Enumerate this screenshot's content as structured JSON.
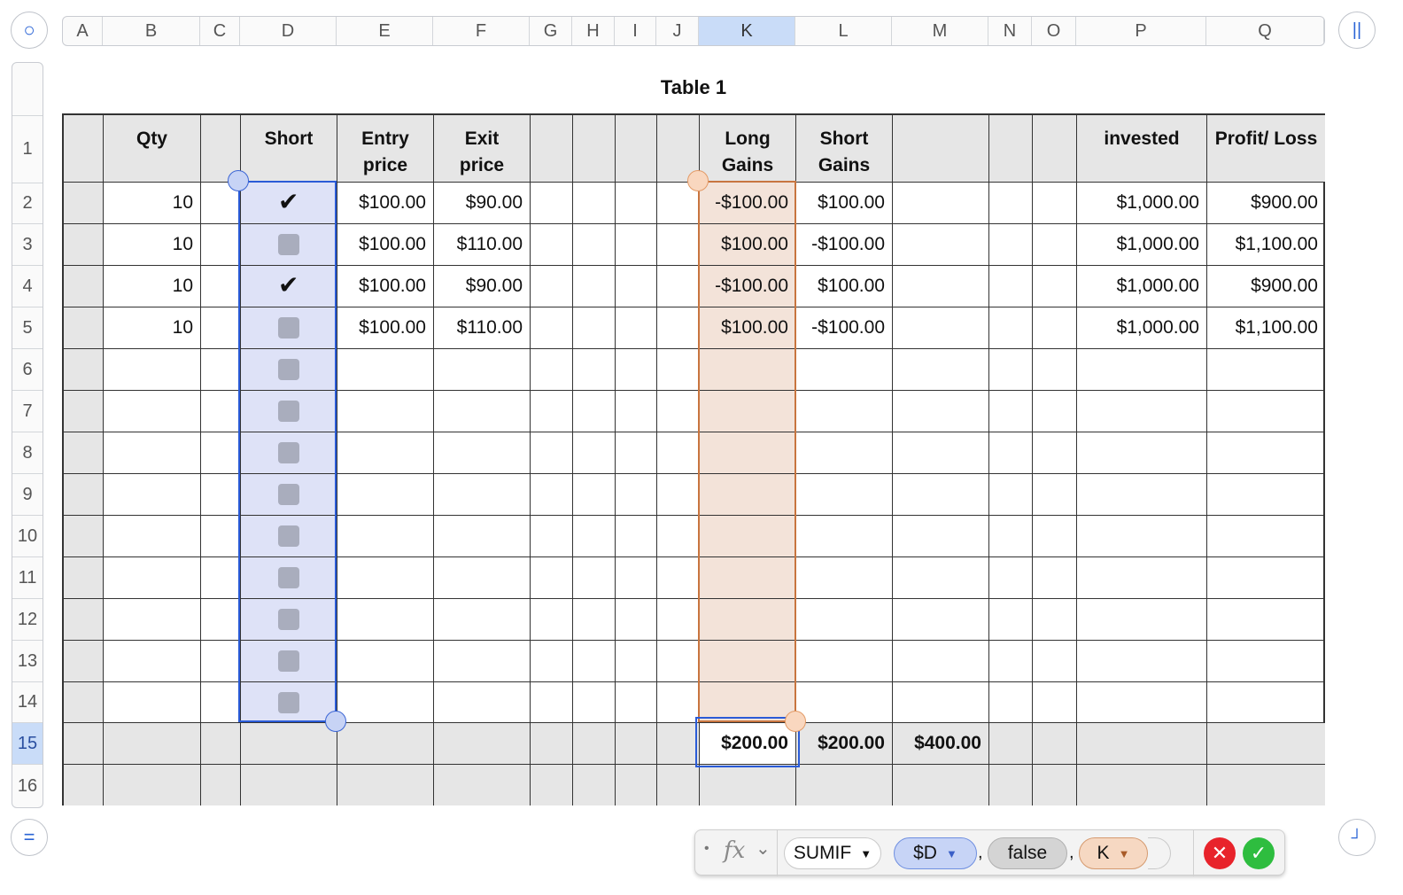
{
  "columns": [
    "A",
    "B",
    "C",
    "D",
    "E",
    "F",
    "G",
    "H",
    "I",
    "J",
    "K",
    "L",
    "M",
    "N",
    "O",
    "P",
    "Q"
  ],
  "selected_column": "K",
  "rows": [
    "1",
    "2",
    "3",
    "4",
    "5",
    "6",
    "7",
    "8",
    "9",
    "10",
    "11",
    "12",
    "13",
    "14",
    "15",
    "16"
  ],
  "selected_row": "15",
  "table_title": "Table 1",
  "headers": {
    "B": "Qty",
    "D": "Short",
    "E": "Entry price",
    "F": "Exit price",
    "K": "Long Gains",
    "L": "Short Gains",
    "P": "invested",
    "Q": "Profit/ Loss"
  },
  "data_rows": [
    {
      "qty": "10",
      "short": true,
      "entry": "$100.00",
      "exit": "$90.00",
      "long_gains": "-$100.00",
      "short_gains": "$100.00",
      "invested": "$1,000.00",
      "profit_loss": "$900.00"
    },
    {
      "qty": "10",
      "short": false,
      "entry": "$100.00",
      "exit": "$110.00",
      "long_gains": "$100.00",
      "short_gains": "-$100.00",
      "invested": "$1,000.00",
      "profit_loss": "$1,100.00"
    },
    {
      "qty": "10",
      "short": true,
      "entry": "$100.00",
      "exit": "$90.00",
      "long_gains": "-$100.00",
      "short_gains": "$100.00",
      "invested": "$1,000.00",
      "profit_loss": "$900.00"
    },
    {
      "qty": "10",
      "short": false,
      "entry": "$100.00",
      "exit": "$110.00",
      "long_gains": "$100.00",
      "short_gains": "-$100.00",
      "invested": "$1,000.00",
      "profit_loss": "$1,100.00"
    }
  ],
  "empty_checkbox_rows": 9,
  "footer": {
    "K": "$200.00",
    "L": "$200.00",
    "M": "$400.00"
  },
  "formula": {
    "bullet": "•",
    "fx_label": "fx",
    "fx_chevron": "⌄",
    "function": "SUMIF",
    "arg1": "$D",
    "arg2": "false",
    "arg3": "K",
    "separator": ","
  },
  "icons": {
    "top_left": "circle-icon",
    "top_right": "pause-icon",
    "bottom_left": "equals-icon",
    "bottom_right": "resize-corner-icon",
    "cancel": "cancel-icon",
    "accept": "accept-icon"
  },
  "colors": {
    "selection_blue": "#2a5bd7",
    "column_d_fill": "#dee2f7",
    "column_k_fill": "#f3e3d9",
    "column_k_border": "#c8753f",
    "header_gray": "#e6e6e6",
    "cancel_red": "#e8232b",
    "accept_green": "#2ebd3f"
  }
}
